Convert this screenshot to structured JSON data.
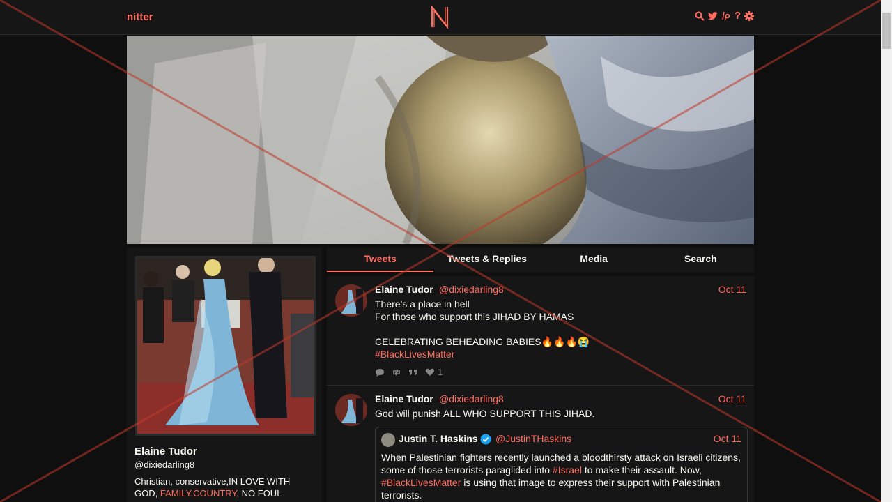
{
  "nav": {
    "brand": "nitter",
    "logo_letter": "N",
    "icons": [
      "search-icon",
      "twitter-icon",
      "lp-icon",
      "help-icon",
      "settings-icon"
    ],
    "help_glyph": "?"
  },
  "profile": {
    "name": "Elaine Tudor",
    "handle": "@dixiedarling8",
    "bio_prefix": "Christian, conservative,IN LOVE WITH GOD, ",
    "bio_link": "FAMILY.COUNTRY",
    "bio_suffix": ", NO FOUL"
  },
  "tabs": [
    {
      "label": "Tweets",
      "active": true
    },
    {
      "label": "Tweets & Replies",
      "active": false
    },
    {
      "label": "Media",
      "active": false
    },
    {
      "label": "Search",
      "active": false
    }
  ],
  "tweets": [
    {
      "name": "Elaine Tudor",
      "handle": "@dixiedarling8",
      "date": "Oct 11",
      "line1": "There's a place in hell",
      "line2": "For those who support this JIHAD BY HAMAS",
      "line3": "CELEBRATING BEHEADING BABIES🔥🔥🔥😭",
      "hashtag": "#BlackLivesMatter",
      "likes": "1"
    },
    {
      "name": "Elaine Tudor",
      "handle": "@dixiedarling8",
      "date": "Oct 11",
      "line1": "God will punish ALL WHO SUPPORT THIS JIHAD.",
      "quote": {
        "name": "Justin T. Haskins",
        "handle": "@JustinTHaskins",
        "date": "Oct 11",
        "text_a": "When Palestinian fighters recently launched a bloodthirsty attack on Israeli citizens, some of those terrorists paraglided into ",
        "tag1": "#Israel",
        "text_b": " to make their assault. Now, ",
        "tag2": "#BlackLivesMatter",
        "text_c": " is using that image to express their support with Palestinian terrorists."
      }
    }
  ],
  "colors": {
    "accent": "#ff6c60",
    "background": "#0f0f0f",
    "panel": "#161616",
    "overlay": "#c0392b"
  }
}
